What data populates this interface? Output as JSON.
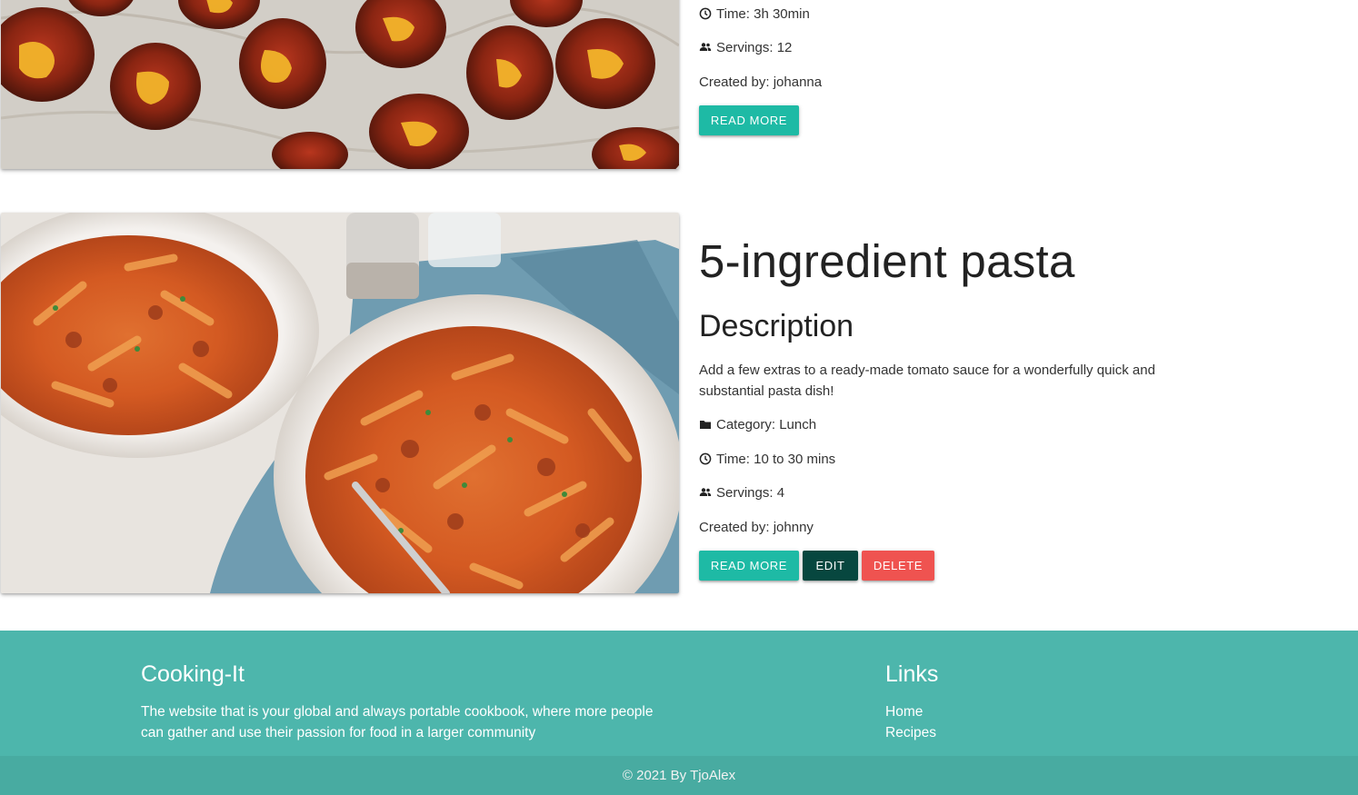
{
  "recipes": [
    {
      "time": "Time: 3h 30min",
      "servings": "Servings: 12",
      "created_by": "Created by: johanna",
      "read_more": "Read more",
      "image_alt": "chicken wings with cheese sauce"
    },
    {
      "title": "5-ingredient pasta",
      "description_heading": "Description",
      "description": "Add a few extras to a ready-made tomato sauce for a wonderfully quick and substantial pasta dish!",
      "category": "Category: Lunch",
      "time": "Time: 10 to 30 mins",
      "servings": "Servings: 4",
      "created_by": "Created by: johnny",
      "read_more": "Read more",
      "edit": "Edit",
      "delete": "Delete",
      "image_alt": "penne pasta with tomato sauce in two bowls"
    }
  ],
  "icons": {
    "clock": "clock-icon",
    "people": "people-icon",
    "folder": "folder-icon"
  },
  "footer": {
    "brand": "Cooking-It",
    "text": "The website that is your global and always portable cookbook, where more people can gather and use their passion for food in a larger community",
    "links_title": "Links",
    "links": [
      "Home",
      "Recipes"
    ],
    "copyright": "© 2021 By TjoAlex"
  },
  "colors": {
    "footer": "#4db6ac",
    "copyright_bar": "#48aba1",
    "read_more": "#1ebaa5",
    "edit": "#07473f",
    "delete": "#ef5350"
  }
}
